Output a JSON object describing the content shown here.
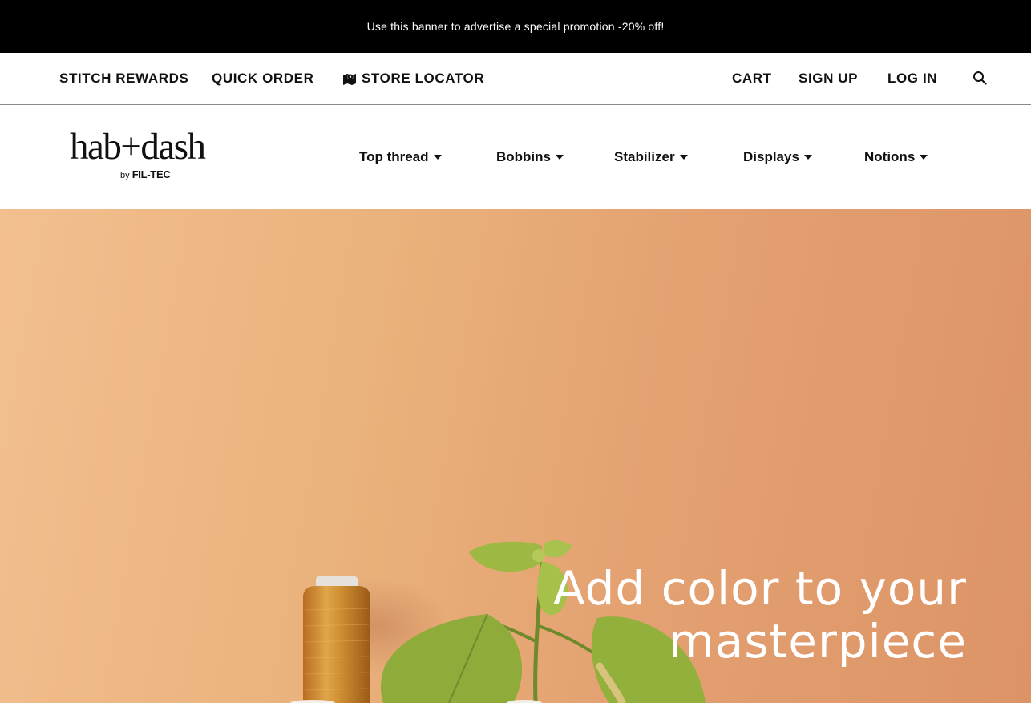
{
  "promo_banner": {
    "text": "Use this banner to advertise a special promotion -20% off!"
  },
  "utility_nav": {
    "stitch_rewards": "STITCH REWARDS",
    "quick_order": "QUICK ORDER",
    "store_locator": "STORE LOCATOR",
    "cart": "CART",
    "sign_up": "SIGN UP",
    "log_in": "LOG IN",
    "icons": {
      "store_locator": "map-marker-icon",
      "search": "search-icon"
    }
  },
  "logo": {
    "wordmark": "hab+dash",
    "by": "by",
    "brand": "FIL-TEC"
  },
  "main_nav": {
    "items": [
      {
        "label": "Top thread"
      },
      {
        "label": "Bobbins"
      },
      {
        "label": "Stabilizer"
      },
      {
        "label": "Displays"
      },
      {
        "label": "Notions"
      }
    ]
  },
  "hero": {
    "line1": "Add color to your",
    "line2": "masterpiece",
    "background_color": "#e8aa78"
  }
}
